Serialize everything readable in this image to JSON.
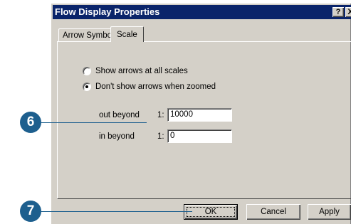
{
  "window": {
    "title": "Flow Display Properties"
  },
  "titlebar": {
    "help_label": "?",
    "close_label": "X"
  },
  "tabs": [
    {
      "label": "Arrow Symbol",
      "selected": false
    },
    {
      "label": "Scale",
      "selected": true
    }
  ],
  "scale": {
    "options": [
      {
        "label": "Show arrows at all scales",
        "checked": false
      },
      {
        "label": "Don't show arrows when zoomed",
        "checked": true
      }
    ],
    "out_beyond": {
      "label": "out beyond",
      "prefix": "1:",
      "value": "10000"
    },
    "in_beyond": {
      "label": "in beyond",
      "prefix": "1:",
      "value": "0"
    }
  },
  "buttons": {
    "ok": "OK",
    "cancel": "Cancel",
    "apply": "Apply"
  },
  "callouts": [
    "6",
    "7"
  ],
  "colors": {
    "titlebar": "#0a246a",
    "dialog": "#d4d0c8",
    "callout": "#1d5f8e"
  }
}
